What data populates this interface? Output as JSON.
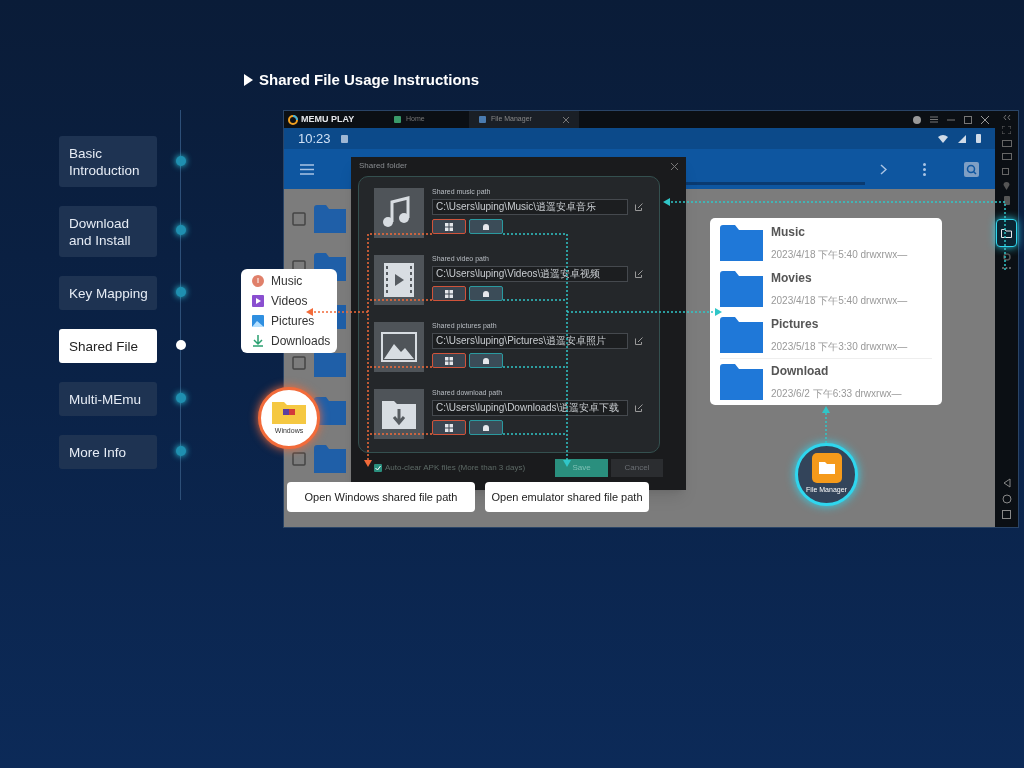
{
  "heading": "Shared File Usage Instructions",
  "nav": [
    {
      "label": "Basic Introduction",
      "selected": false
    },
    {
      "label": "Download and Install",
      "selected": false
    },
    {
      "label": "Key Mapping",
      "selected": false
    },
    {
      "label": "Shared File",
      "selected": true
    },
    {
      "label": "Multi-MEmu",
      "selected": false
    },
    {
      "label": "More Info",
      "selected": false
    }
  ],
  "emulator": {
    "logo": "MEMU PLAY",
    "tabs": [
      {
        "label": "Home",
        "selected": false
      },
      {
        "label": "File Manager",
        "selected": true
      }
    ],
    "time": "10:23"
  },
  "dialog": {
    "title": "Shared folder",
    "sections": [
      {
        "kind": "music",
        "label": "Shared music path",
        "path": "C:\\Users\\luping\\Music\\逍遥安卓音乐"
      },
      {
        "kind": "video",
        "label": "Shared video path",
        "path": "C:\\Users\\luping\\Videos\\逍遥安卓视频"
      },
      {
        "kind": "pictures",
        "label": "Shared pictures path",
        "path": "C:\\Users\\luping\\Pictures\\逍遥安卓照片"
      },
      {
        "kind": "download",
        "label": "Shared download path",
        "path": "C:\\Users\\luping\\Downloads\\逍遥安卓下载"
      }
    ],
    "auto_clear": {
      "label": "Auto-clear APK files (More than 3 days)",
      "checked": true
    },
    "buttons": [
      "Save",
      "Cancel"
    ]
  },
  "windows_menu": [
    {
      "kind": "music",
      "label": "Music"
    },
    {
      "kind": "video",
      "label": "Videos"
    },
    {
      "kind": "pictures",
      "label": "Pictures"
    },
    {
      "kind": "download",
      "label": "Downloads"
    }
  ],
  "windows_badge": "Windows",
  "callouts": [
    "Open Windows shared file path",
    "Open emulator shared file path"
  ],
  "folders": [
    {
      "name": "Music",
      "info": "2023/4/18 下午5:40  drwxrwx—"
    },
    {
      "name": "Movies",
      "info": "2023/4/18 下午5:40  drwxrwx—"
    },
    {
      "name": "Pictures",
      "info": "2023/5/18 下午3:30  drwxrwx—"
    },
    {
      "name": "Download",
      "info": "2023/6/2 下午6:33  drwxrwx—"
    }
  ],
  "file_manager_badge": "File Manager"
}
